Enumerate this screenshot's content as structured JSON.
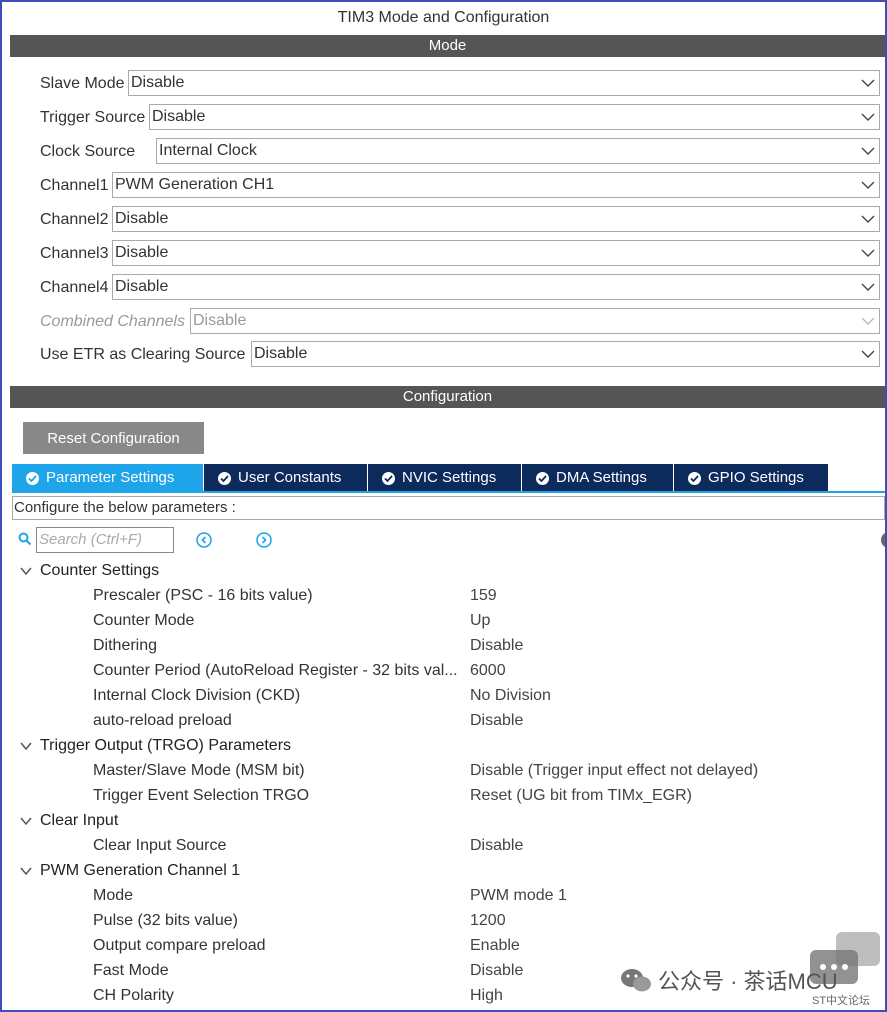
{
  "window": {
    "title": "TIM3 Mode and Configuration"
  },
  "mode": {
    "header": "Mode",
    "fields": [
      {
        "label": "Slave Mode",
        "value": "Disable"
      },
      {
        "label": "Trigger Source",
        "value": "Disable"
      },
      {
        "label": "Clock Source",
        "value": "Internal Clock"
      },
      {
        "label": "Channel1",
        "value": "PWM Generation CH1"
      },
      {
        "label": "Channel2",
        "value": "Disable"
      },
      {
        "label": "Channel3",
        "value": "Disable"
      },
      {
        "label": "Channel4",
        "value": "Disable"
      },
      {
        "label": "Combined Channels",
        "value": "Disable",
        "disabled": true
      },
      {
        "label": "Use ETR as Clearing Source",
        "value": "Disable"
      }
    ]
  },
  "configuration": {
    "header": "Configuration",
    "reset_label": "Reset Configuration",
    "tabs": [
      {
        "label": "Parameter Settings",
        "active": true
      },
      {
        "label": "User Constants"
      },
      {
        "label": "NVIC Settings"
      },
      {
        "label": "DMA Settings"
      },
      {
        "label": "GPIO Settings"
      }
    ],
    "hint": "Configure the below parameters :",
    "search_placeholder": "Search (Ctrl+F)",
    "groups": [
      {
        "name": "Counter Settings",
        "params": [
          {
            "name": "Prescaler (PSC - 16 bits value)",
            "value": "159"
          },
          {
            "name": "Counter Mode",
            "value": "Up"
          },
          {
            "name": "Dithering",
            "value": "Disable"
          },
          {
            "name": "Counter Period (AutoReload Register - 32 bits val...",
            "value": "6000"
          },
          {
            "name": "Internal Clock Division (CKD)",
            "value": "No Division"
          },
          {
            "name": "auto-reload preload",
            "value": "Disable"
          }
        ]
      },
      {
        "name": "Trigger Output (TRGO) Parameters",
        "params": [
          {
            "name": "Master/Slave Mode (MSM bit)",
            "value": "Disable (Trigger input effect not delayed)"
          },
          {
            "name": "Trigger Event Selection TRGO",
            "value": "Reset (UG bit from TIMx_EGR)"
          }
        ]
      },
      {
        "name": "Clear Input",
        "params": [
          {
            "name": "Clear Input Source",
            "value": "Disable"
          }
        ]
      },
      {
        "name": "PWM Generation Channel 1",
        "params": [
          {
            "name": "Mode",
            "value": "PWM mode 1"
          },
          {
            "name": "Pulse (32 bits value)",
            "value": "1200"
          },
          {
            "name": "Output compare preload",
            "value": "Enable"
          },
          {
            "name": "Fast Mode",
            "value": "Disable"
          },
          {
            "name": "CH Polarity",
            "value": "High"
          }
        ]
      }
    ]
  },
  "watermark": {
    "text": "公众号 · 茶话MCU",
    "sub": "ST中文论坛"
  },
  "colors": {
    "accent": "#1ea4e9",
    "tab_bg": "#0d2a5c",
    "band": "#555555",
    "frame": "#3c4fb8"
  }
}
